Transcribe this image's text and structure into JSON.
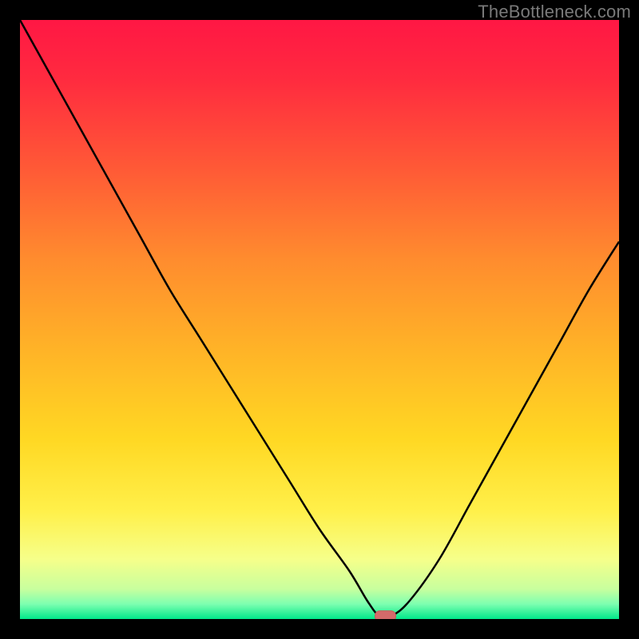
{
  "watermark": "TheBottleneck.com",
  "chart_data": {
    "type": "line",
    "title": "",
    "xlabel": "",
    "ylabel": "",
    "xlim": [
      0,
      100
    ],
    "ylim": [
      0,
      100
    ],
    "x": [
      0,
      5,
      10,
      15,
      20,
      25,
      30,
      35,
      40,
      45,
      50,
      55,
      58,
      60,
      62,
      65,
      70,
      75,
      80,
      85,
      90,
      95,
      100
    ],
    "y": [
      100,
      91,
      82,
      73,
      64,
      55,
      47,
      39,
      31,
      23,
      15,
      8,
      3,
      0.5,
      0.5,
      3,
      10,
      19,
      28,
      37,
      46,
      55,
      63
    ],
    "marker": {
      "x": 61,
      "y": 0.5
    },
    "gradient_stops": [
      {
        "offset": 0.0,
        "color": "#ff1744"
      },
      {
        "offset": 0.1,
        "color": "#ff2b3f"
      },
      {
        "offset": 0.25,
        "color": "#ff5a36"
      },
      {
        "offset": 0.4,
        "color": "#ff8c2e"
      },
      {
        "offset": 0.55,
        "color": "#ffb327"
      },
      {
        "offset": 0.7,
        "color": "#ffd823"
      },
      {
        "offset": 0.82,
        "color": "#fff04a"
      },
      {
        "offset": 0.9,
        "color": "#f6ff8a"
      },
      {
        "offset": 0.95,
        "color": "#c8ff9e"
      },
      {
        "offset": 0.975,
        "color": "#7dffb0"
      },
      {
        "offset": 1.0,
        "color": "#00e88a"
      }
    ],
    "colors": {
      "line": "#000000",
      "marker_fill": "#d46a6a",
      "marker_stroke": "#c85a5a"
    }
  }
}
